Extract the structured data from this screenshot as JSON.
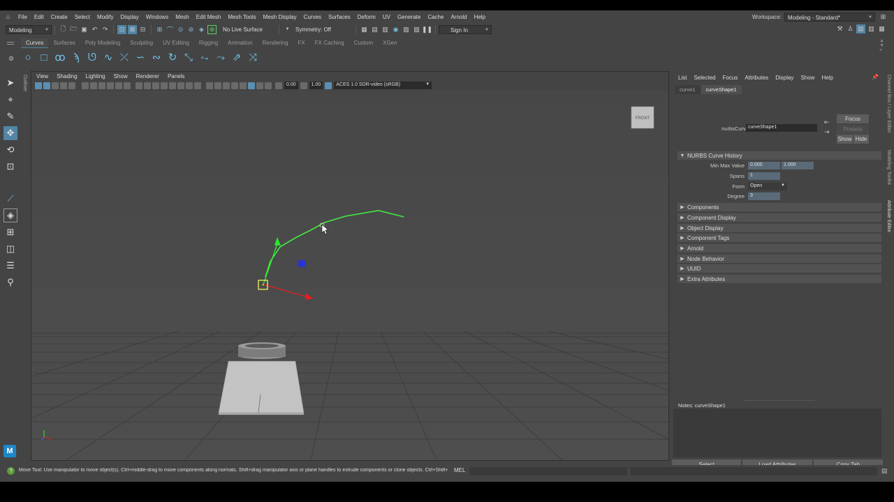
{
  "menubar": {
    "items": [
      "File",
      "Edit",
      "Create",
      "Select",
      "Modify",
      "Display",
      "Windows",
      "Mesh",
      "Edit Mesh",
      "Mesh Tools",
      "Mesh Display",
      "Curves",
      "Surfaces",
      "Deform",
      "UV",
      "Generate",
      "Cache",
      "Arnold",
      "Help"
    ],
    "workspace_label": "Workspace:",
    "workspace_value": "Modeling - Standard*"
  },
  "statusline": {
    "mode": "Modeling",
    "live_surface": "No Live Surface",
    "symmetry": "Symmetry: Off",
    "sign_in": "Sign In"
  },
  "shelf": {
    "tabs": [
      "Curves",
      "Surfaces",
      "Poly Modeling",
      "Sculpting",
      "UV Editing",
      "Rigging",
      "Animation",
      "Rendering",
      "FX",
      "FX Caching",
      "Custom",
      "XGen"
    ],
    "active_tab": "Curves"
  },
  "viewport": {
    "menu": [
      "View",
      "Shading",
      "Lighting",
      "Show",
      "Renderer",
      "Panels"
    ],
    "exposure": "0.00",
    "gamma": "1.00",
    "colorspace": "ACES 1.0 SDR-video (sRGB)",
    "view_cube_label": "FRONT"
  },
  "attribute_editor": {
    "menu": [
      "List",
      "Selected",
      "Focus",
      "Attributes",
      "Display",
      "Show",
      "Help"
    ],
    "tabs": [
      "curve1",
      "curveShape1"
    ],
    "active_tab": "curveShape1",
    "node_type_label": "nurbsCurve:",
    "node_name": "curveShape1",
    "focus_label": "Focus",
    "presets_label": "Presets",
    "show_label": "Show",
    "hide_label": "Hide",
    "history_section": "NURBS Curve History",
    "fields": {
      "min_max_label": "Min Max Value",
      "min_value": "0.000",
      "max_value": "1.000",
      "spans_label": "Spans",
      "spans_value": "1",
      "form_label": "Form",
      "form_value": "Open",
      "degree_label": "Degree",
      "degree_value": "3"
    },
    "sections": [
      "Components",
      "Component Display",
      "Object Display",
      "Component Tags",
      "Arnold",
      "Node Behavior",
      "UUID",
      "Extra Attributes"
    ],
    "notes_label": "Notes:  curveShape1",
    "bottom_buttons": [
      "Select",
      "Load Attributes",
      "Copy Tab"
    ],
    "side_tabs": [
      "Channel Box / Layer Editor",
      "Modeling Toolkit",
      "Attribute Editor"
    ]
  },
  "helpline": {
    "text": "Move Tool: Use manipulator to move object(s). Ctrl+middle-drag to move components along normals. Shift+drag manipulator axis or plane handles to extrude components or clone objects. Ctrl+Shift+drag to c",
    "mel_label": "MEL"
  },
  "outliner_label": "Outliner",
  "colors": {
    "accent": "#5285a6",
    "curve": "#43e843",
    "move_x": "#e02020",
    "move_y": "#2ee62e",
    "move_z": "#2a33d6"
  }
}
